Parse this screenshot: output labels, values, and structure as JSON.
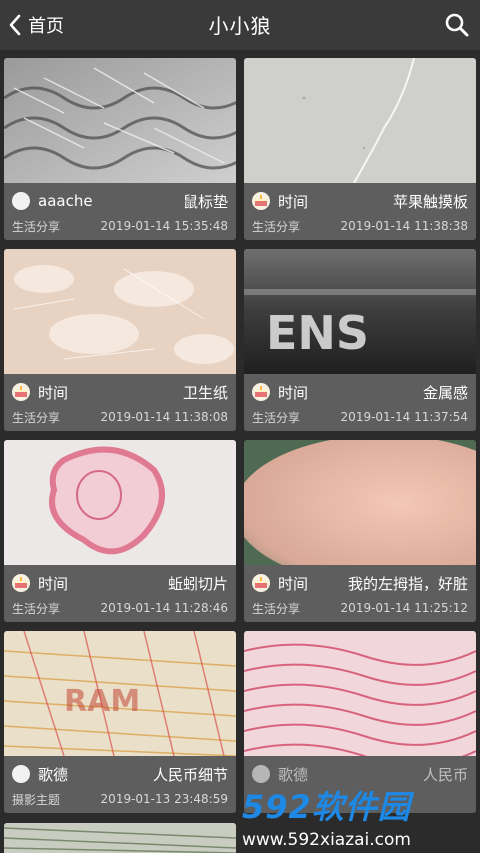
{
  "header": {
    "back_label": "首页",
    "title": "小小狼"
  },
  "cards": [
    {
      "author": "aaache",
      "name": "鼠标垫",
      "category": "生活分享",
      "date": "2019-01-14 15:35:48",
      "avatar": "plain"
    },
    {
      "author": "时间",
      "name": "苹果触摸板",
      "category": "生活分享",
      "date": "2019-01-14 11:38:38",
      "avatar": "cake"
    },
    {
      "author": "时间",
      "name": "卫生纸",
      "category": "生活分享",
      "date": "2019-01-14 11:38:08",
      "avatar": "cake"
    },
    {
      "author": "时间",
      "name": "金属感",
      "category": "生活分享",
      "date": "2019-01-14 11:37:54",
      "avatar": "cake"
    },
    {
      "author": "时间",
      "name": "蚯蚓切片",
      "category": "生活分享",
      "date": "2019-01-14 11:28:46",
      "avatar": "cake"
    },
    {
      "author": "时间",
      "name": "我的左拇指，好脏",
      "category": "生活分享",
      "date": "2019-01-14 11:25:12",
      "avatar": "cake"
    },
    {
      "author": "歌德",
      "name": "人民币细节",
      "category": "摄影主题",
      "date": "2019-01-13 23:48:59",
      "avatar": "plain"
    },
    {
      "author": "歌德",
      "name": "人民币",
      "category": "",
      "date": "",
      "avatar": "plain"
    }
  ],
  "watermark": {
    "logo": "592软件园",
    "url": "www.592xiazai.com"
  }
}
